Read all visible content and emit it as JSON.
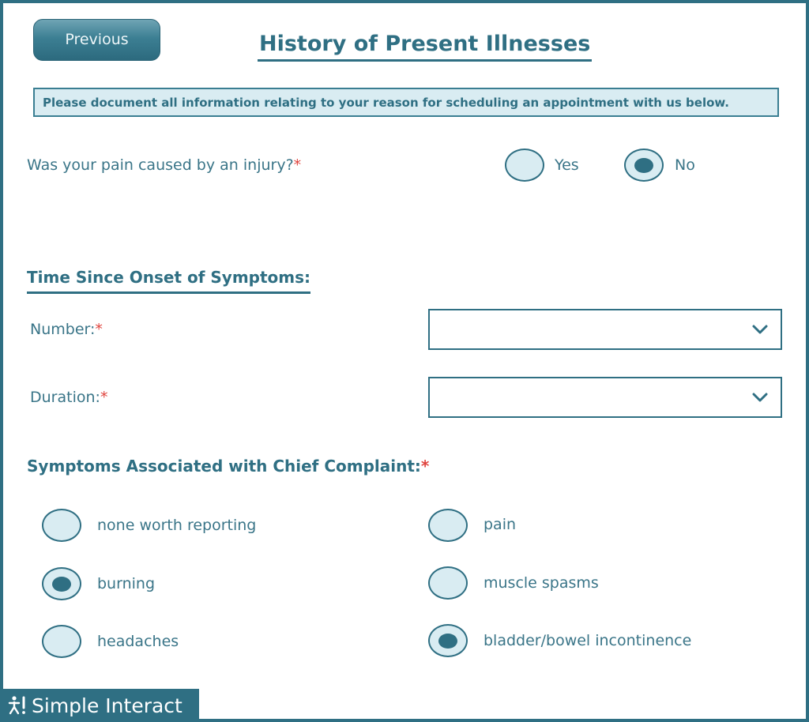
{
  "header": {
    "previous_label": "Previous",
    "title": "History of Present Illnesses"
  },
  "notice": "Please document all information relating to your reason for scheduling an appointment with us below.",
  "injury_question": {
    "label": "Was your pain caused by an injury?",
    "required_mark": "*",
    "options": [
      {
        "label": "Yes",
        "selected": false
      },
      {
        "label": "No",
        "selected": true
      }
    ]
  },
  "onset": {
    "title": "Time Since Onset of Symptoms:",
    "number_label": "Number:",
    "duration_label": "Duration:",
    "required_mark": "*",
    "number_value": "",
    "duration_value": ""
  },
  "symptoms": {
    "title": "Symptoms Associated with Chief Complaint:",
    "required_mark": "*",
    "options": [
      {
        "label": "none worth reporting",
        "selected": false
      },
      {
        "label": "pain",
        "selected": false
      },
      {
        "label": "burning",
        "selected": true
      },
      {
        "label": "muscle spasms",
        "selected": false
      },
      {
        "label": "headaches",
        "selected": false
      },
      {
        "label": "bladder/bowel incontinence",
        "selected": true
      }
    ]
  },
  "footer": {
    "brand_text": "Simple Interact",
    "logo_icon": "person-exclamation-icon"
  },
  "colors": {
    "primary": "#2f6f83",
    "radio_fill": "#d9ecf2",
    "required": "#e0443e",
    "text": "#3a7588"
  }
}
